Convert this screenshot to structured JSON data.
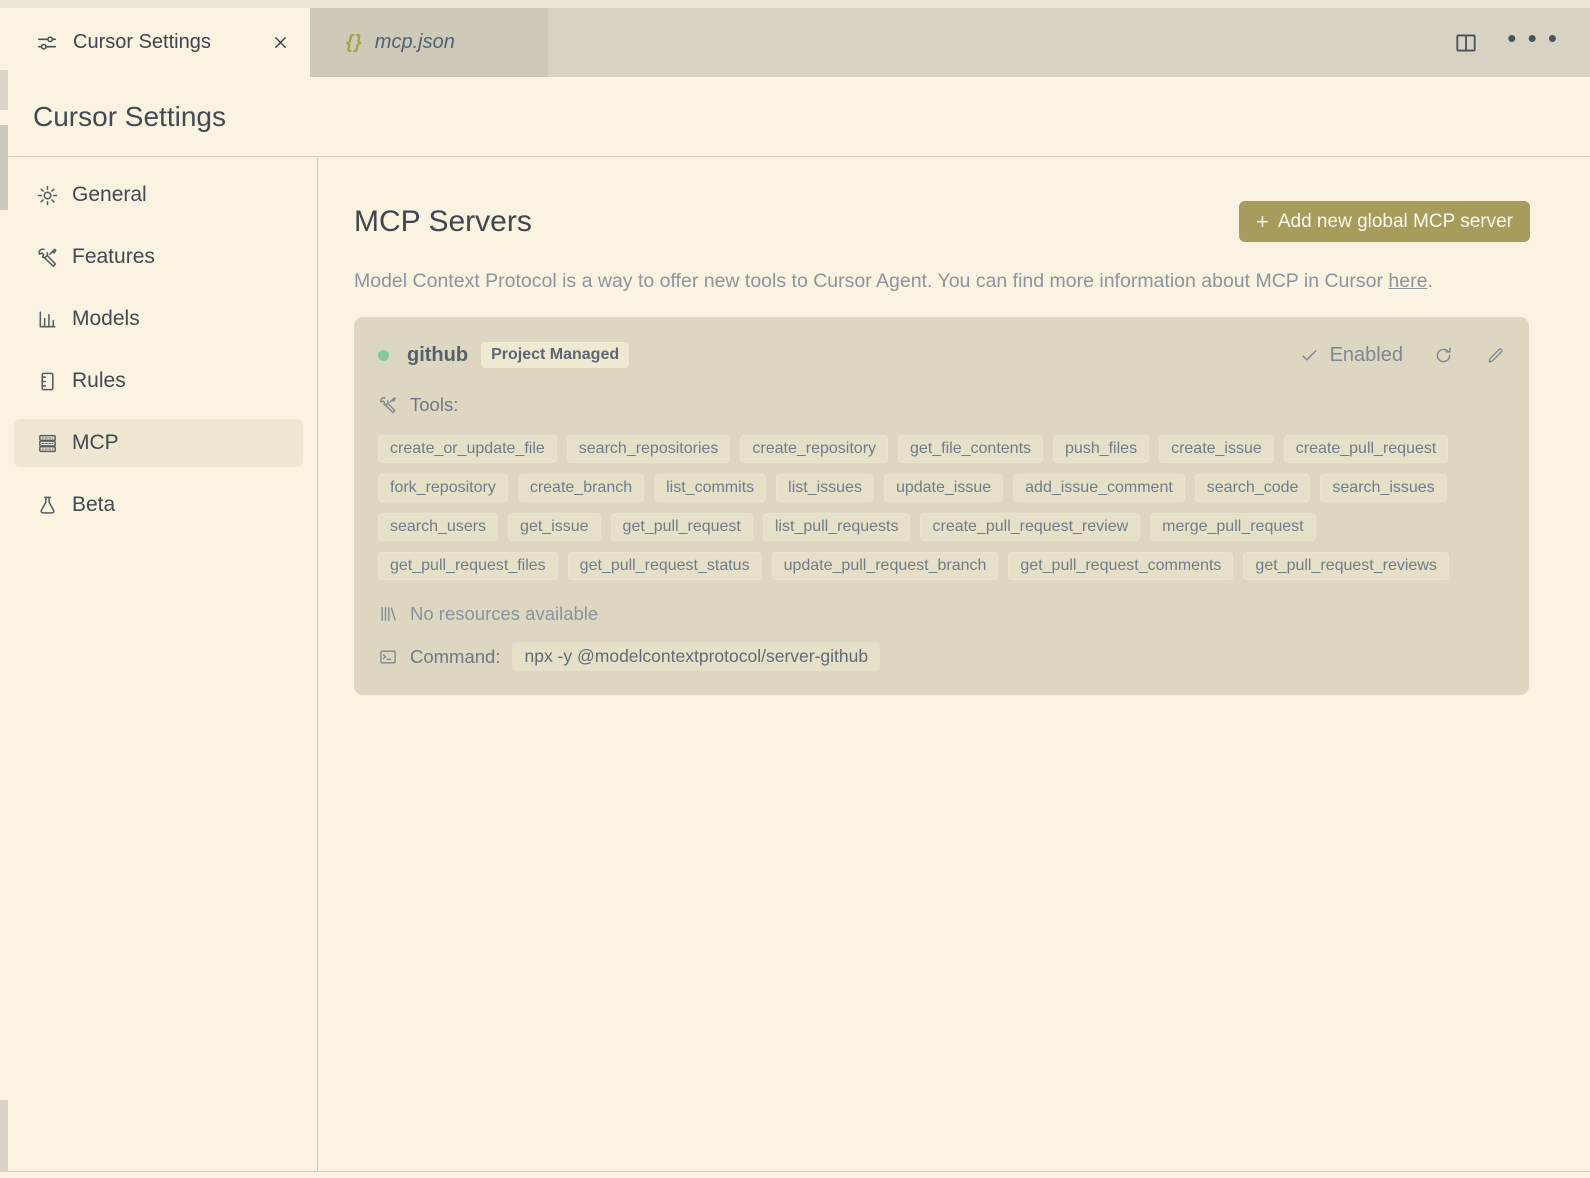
{
  "colors": {
    "accent_olive": "#a79c5c",
    "status_green": "#82c9a0",
    "background_cream": "#faf3e2",
    "card_tan": "#ddd6c1",
    "tab_bar": "#d8d2c4"
  },
  "tab_bar": {
    "tabs": [
      {
        "label": "Cursor Settings",
        "icon": "sliders-icon",
        "active": true,
        "closable": true
      },
      {
        "label": "mcp.json",
        "icon": "json-braces-icon",
        "preview": true
      }
    ],
    "braces_glyph": "{}",
    "actions": {
      "split_editor": "split-editor-icon",
      "more": "ellipsis-icon"
    }
  },
  "page_header": {
    "title": "Cursor Settings"
  },
  "sidebar": {
    "items": [
      {
        "label": "General",
        "icon": "gear-icon",
        "selected": false
      },
      {
        "label": "Features",
        "icon": "tools-icon",
        "selected": false
      },
      {
        "label": "Models",
        "icon": "bar-chart-icon",
        "selected": false
      },
      {
        "label": "Rules",
        "icon": "rules-icon",
        "selected": false
      },
      {
        "label": "MCP",
        "icon": "server-stack-icon",
        "selected": true
      },
      {
        "label": "Beta",
        "icon": "flask-icon",
        "selected": false
      }
    ]
  },
  "main": {
    "title": "MCP Servers",
    "add_button": {
      "icon": "+",
      "label": "Add new global MCP server"
    },
    "description": {
      "text_before_link": "Model Context Protocol is a way to offer new tools to Cursor Agent. You can find more information about MCP in Cursor ",
      "link_text": "here",
      "text_after_link": "."
    }
  },
  "server_card": {
    "name": "github",
    "badge": "Project Managed",
    "status_label": "Enabled",
    "tools_label": "Tools:",
    "tools": [
      "create_or_update_file",
      "search_repositories",
      "create_repository",
      "get_file_contents",
      "push_files",
      "create_issue",
      "create_pull_request",
      "fork_repository",
      "create_branch",
      "list_commits",
      "list_issues",
      "update_issue",
      "add_issue_comment",
      "search_code",
      "search_issues",
      "search_users",
      "get_issue",
      "get_pull_request",
      "list_pull_requests",
      "create_pull_request_review",
      "merge_pull_request",
      "get_pull_request_files",
      "get_pull_request_status",
      "update_pull_request_branch",
      "get_pull_request_comments",
      "get_pull_request_reviews"
    ],
    "resources_text": "No resources available",
    "command_label": "Command:",
    "command_value": "npx -y @modelcontextprotocol/server-github"
  }
}
